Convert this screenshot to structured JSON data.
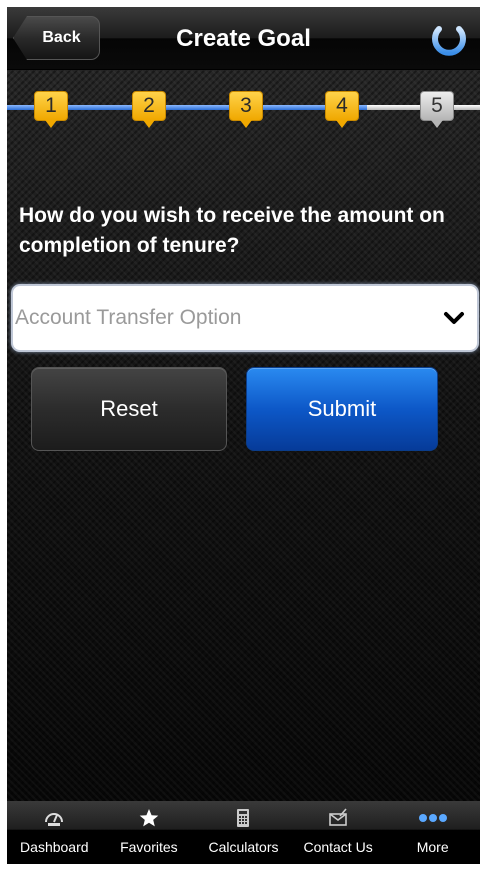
{
  "header": {
    "back_label": "Back",
    "title": "Create Goal"
  },
  "progress": {
    "steps": [
      "1",
      "2",
      "3",
      "4",
      "5"
    ],
    "current_step": 5
  },
  "question": "How do you wish to receive the amount on completion of tenure?",
  "select": {
    "placeholder": "Account Transfer Option"
  },
  "actions": {
    "reset_label": "Reset",
    "submit_label": "Submit"
  },
  "tabbar": {
    "items": [
      {
        "label": "Dashboard",
        "icon": "gauge-icon"
      },
      {
        "label": "Favorites",
        "icon": "star-icon"
      },
      {
        "label": "Calculators",
        "icon": "calculator-icon"
      },
      {
        "label": "Contact Us",
        "icon": "envelope-icon"
      },
      {
        "label": "More",
        "icon": "more-dots-icon"
      }
    ]
  },
  "colors": {
    "accent_blue": "#0d58c8",
    "step_done": "#f0a800",
    "step_pending": "#b5b5b5"
  }
}
